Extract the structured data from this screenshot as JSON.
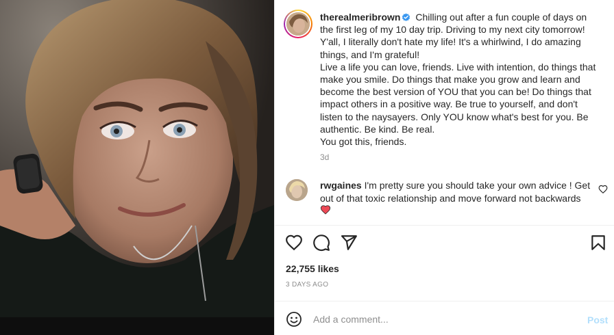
{
  "post": {
    "username": "therealmeribrown",
    "caption_lines": [
      "Chilling out after a fun couple of days on the first leg of my 10 day trip. Driving to my next city tomorrow! Y'all, I literally don't hate my life! It's a whirlwind, I do amazing things, and I'm grateful!",
      "Live a life you can love, friends. Live with intention, do things that make you smile. Do things that make you grow and learn and become the best version of YOU that you can be! Do things that impact others in a positive way. Be true to yourself, and don't listen to the naysayers. Only YOU know what's best for you. Be authentic. Be kind. Be real.",
      "You got this, friends."
    ],
    "time_ago": "3d"
  },
  "comment": {
    "username": "rwgaines",
    "text": "I'm pretty sure you should take your own advice ! Get out of that toxic relationship and move forward not backwards"
  },
  "actions": {
    "like_icon": "heart-icon",
    "comment_icon": "comment-bubble-icon",
    "share_icon": "paper-plane-icon",
    "save_icon": "bookmark-icon"
  },
  "stats": {
    "likes": "22,755 likes",
    "date": "3 DAYS AGO"
  },
  "compose": {
    "placeholder": "Add a comment...",
    "post_label": "Post"
  },
  "colors": {
    "verified_badge": "#3897f0",
    "liked_heart": "#ed4956",
    "post_button_disabled": "#b2dffc"
  }
}
